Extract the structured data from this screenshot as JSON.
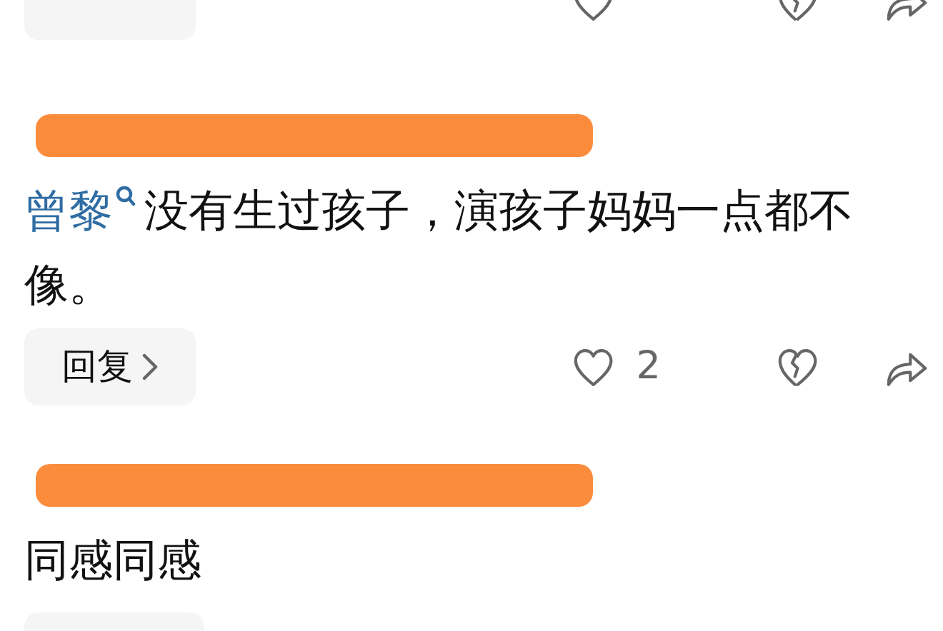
{
  "comments": [
    {
      "kind": "tail"
    },
    {
      "kind": "full",
      "author_redacted": true,
      "mention": "曾黎",
      "text": "没有生过孩子，演孩子妈妈一点都不像。",
      "reply": "回复",
      "likes": "2"
    },
    {
      "kind": "head",
      "author_redacted": true,
      "text": "同感同感"
    }
  ]
}
